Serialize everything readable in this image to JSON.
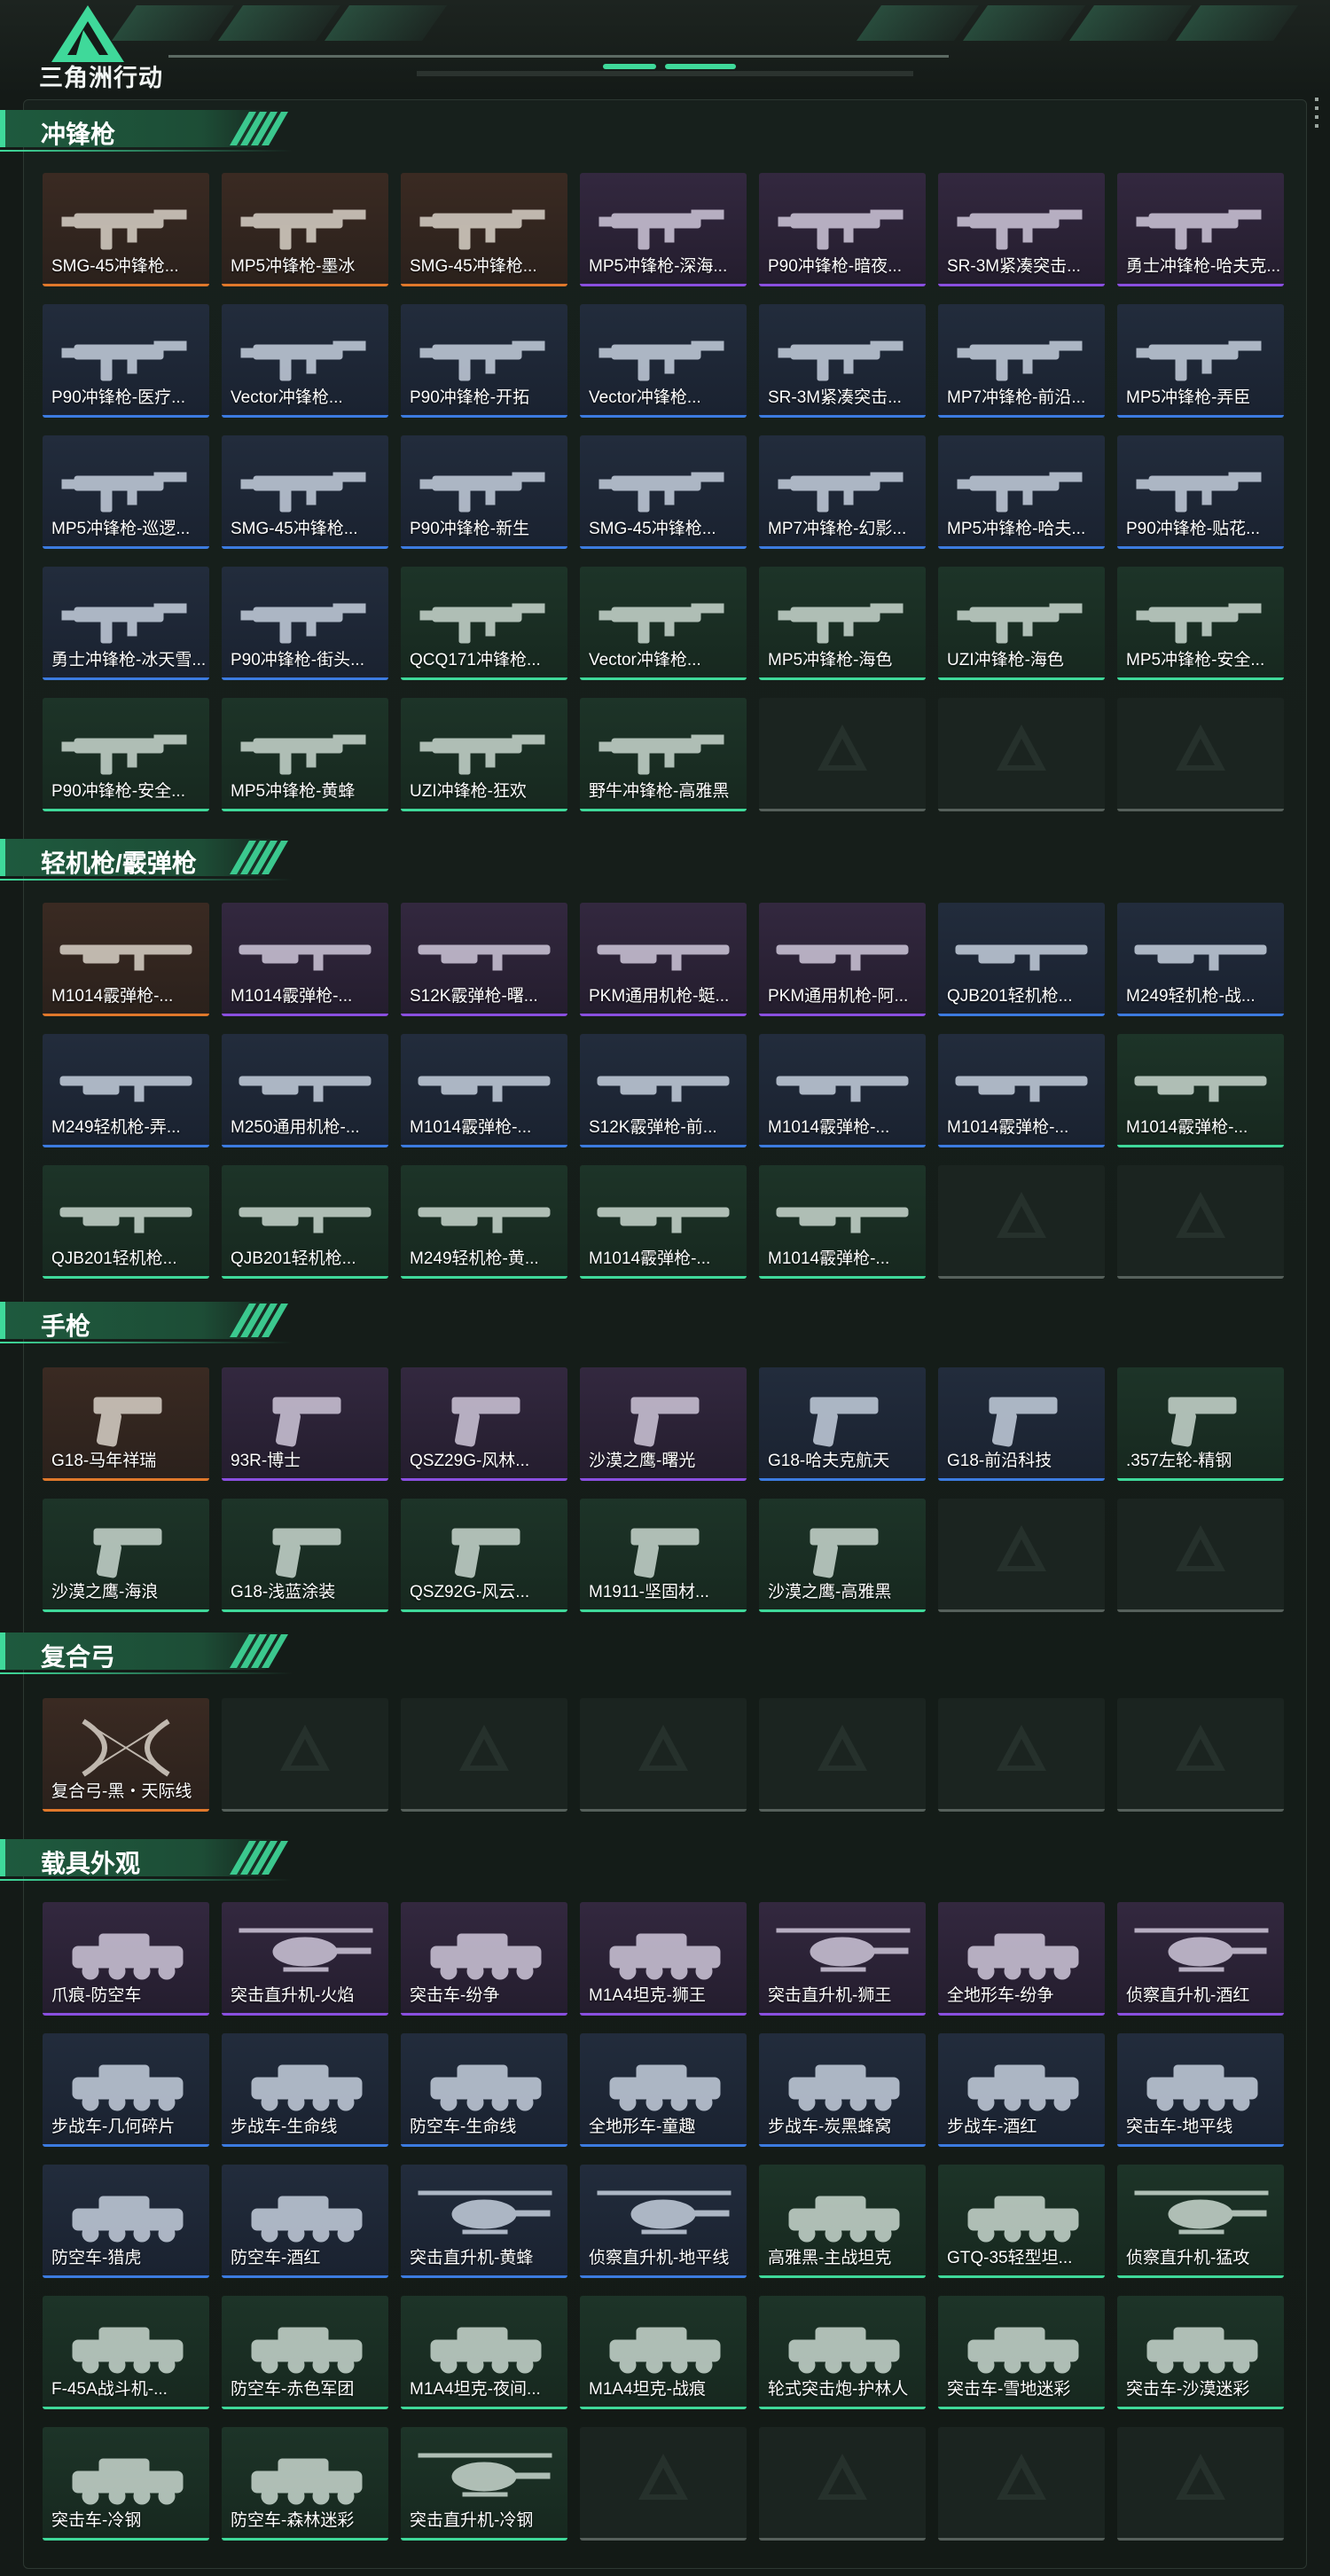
{
  "header": {
    "logo_text": "三角洲行动",
    "logo_icon": "delta-triangle-logo-icon",
    "accent_color": "#3fd99a"
  },
  "sections": [
    {
      "title": "冲锋枪",
      "cards": [
        {
          "label": "SMG-45冲锋枪...",
          "rarity": "orange"
        },
        {
          "label": "MP5冲锋枪-墨冰",
          "rarity": "orange"
        },
        {
          "label": "SMG-45冲锋枪...",
          "rarity": "orange"
        },
        {
          "label": "MP5冲锋枪-深海...",
          "rarity": "purple"
        },
        {
          "label": "P90冲锋枪-暗夜...",
          "rarity": "purple"
        },
        {
          "label": "SR-3M紧凑突击...",
          "rarity": "purple"
        },
        {
          "label": "勇士冲锋枪-哈夫克...",
          "rarity": "purple"
        },
        {
          "label": "P90冲锋枪-医疗...",
          "rarity": "blue"
        },
        {
          "label": "Vector冲锋枪...",
          "rarity": "blue"
        },
        {
          "label": "P90冲锋枪-开拓",
          "rarity": "blue"
        },
        {
          "label": "Vector冲锋枪...",
          "rarity": "blue"
        },
        {
          "label": "SR-3M紧凑突击...",
          "rarity": "blue"
        },
        {
          "label": "MP7冲锋枪-前沿...",
          "rarity": "blue"
        },
        {
          "label": "MP5冲锋枪-弄臣",
          "rarity": "blue"
        },
        {
          "label": "MP5冲锋枪-巡逻...",
          "rarity": "blue"
        },
        {
          "label": "SMG-45冲锋枪...",
          "rarity": "blue"
        },
        {
          "label": "P90冲锋枪-新生",
          "rarity": "blue"
        },
        {
          "label": "SMG-45冲锋枪...",
          "rarity": "blue"
        },
        {
          "label": "MP7冲锋枪-幻影...",
          "rarity": "blue"
        },
        {
          "label": "MP5冲锋枪-哈夫...",
          "rarity": "blue"
        },
        {
          "label": "P90冲锋枪-贴花...",
          "rarity": "blue"
        },
        {
          "label": "勇士冲锋枪-冰天雪...",
          "rarity": "blue"
        },
        {
          "label": "P90冲锋枪-街头...",
          "rarity": "blue"
        },
        {
          "label": "QCQ171冲锋枪...",
          "rarity": "green"
        },
        {
          "label": "Vector冲锋枪...",
          "rarity": "green"
        },
        {
          "label": "MP5冲锋枪-海色",
          "rarity": "green"
        },
        {
          "label": "UZI冲锋枪-海色",
          "rarity": "green"
        },
        {
          "label": "MP5冲锋枪-安全...",
          "rarity": "green"
        },
        {
          "label": "P90冲锋枪-安全...",
          "rarity": "green"
        },
        {
          "label": "MP5冲锋枪-黄蜂",
          "rarity": "green"
        },
        {
          "label": "UZI冲锋枪-狂欢",
          "rarity": "green"
        },
        {
          "label": "野牛冲锋枪-高雅黑",
          "rarity": "green"
        },
        {
          "label": "",
          "rarity": "empty"
        },
        {
          "label": "",
          "rarity": "empty"
        },
        {
          "label": "",
          "rarity": "empty"
        }
      ]
    },
    {
      "title": "轻机枪/霰弹枪",
      "cards": [
        {
          "label": "M1014霰弹枪-...",
          "rarity": "orange"
        },
        {
          "label": "M1014霰弹枪-...",
          "rarity": "purple"
        },
        {
          "label": "S12K霰弹枪-曙...",
          "rarity": "purple"
        },
        {
          "label": "PKM通用机枪-蜓...",
          "rarity": "purple"
        },
        {
          "label": "PKM通用机枪-阿...",
          "rarity": "purple"
        },
        {
          "label": "QJB201轻机枪...",
          "rarity": "blue"
        },
        {
          "label": "M249轻机枪-战...",
          "rarity": "blue"
        },
        {
          "label": "M249轻机枪-弄...",
          "rarity": "blue"
        },
        {
          "label": "M250通用机枪-...",
          "rarity": "blue"
        },
        {
          "label": "M1014霰弹枪-...",
          "rarity": "blue"
        },
        {
          "label": "S12K霰弹枪-前...",
          "rarity": "blue"
        },
        {
          "label": "M1014霰弹枪-...",
          "rarity": "blue"
        },
        {
          "label": "M1014霰弹枪-...",
          "rarity": "blue"
        },
        {
          "label": "M1014霰弹枪-...",
          "rarity": "green"
        },
        {
          "label": "QJB201轻机枪...",
          "rarity": "green"
        },
        {
          "label": "QJB201轻机枪...",
          "rarity": "green"
        },
        {
          "label": "M249轻机枪-黄...",
          "rarity": "green"
        },
        {
          "label": "M1014霰弹枪-...",
          "rarity": "green"
        },
        {
          "label": "M1014霰弹枪-...",
          "rarity": "green"
        },
        {
          "label": "",
          "rarity": "empty"
        },
        {
          "label": "",
          "rarity": "empty"
        }
      ]
    },
    {
      "title": "手枪",
      "cards": [
        {
          "label": "G18-马年祥瑞",
          "rarity": "orange"
        },
        {
          "label": "93R-博士",
          "rarity": "purple"
        },
        {
          "label": "QSZ29G-风林...",
          "rarity": "purple"
        },
        {
          "label": "沙漠之鹰-曙光",
          "rarity": "purple"
        },
        {
          "label": "G18-哈夫克航天",
          "rarity": "blue"
        },
        {
          "label": "G18-前沿科技",
          "rarity": "blue"
        },
        {
          "label": ".357左轮-精钢",
          "rarity": "green"
        },
        {
          "label": "沙漠之鹰-海浪",
          "rarity": "green"
        },
        {
          "label": "G18-浅蓝涂装",
          "rarity": "green"
        },
        {
          "label": "QSZ92G-风云...",
          "rarity": "green"
        },
        {
          "label": "M1911-坚固材...",
          "rarity": "green"
        },
        {
          "label": "沙漠之鹰-高雅黑",
          "rarity": "green"
        },
        {
          "label": "",
          "rarity": "empty"
        },
        {
          "label": "",
          "rarity": "empty"
        }
      ]
    },
    {
      "title": "复合弓",
      "cards": [
        {
          "label": "复合弓-黑・天际线",
          "rarity": "orange"
        },
        {
          "label": "",
          "rarity": "empty"
        },
        {
          "label": "",
          "rarity": "empty"
        },
        {
          "label": "",
          "rarity": "empty"
        },
        {
          "label": "",
          "rarity": "empty"
        },
        {
          "label": "",
          "rarity": "empty"
        },
        {
          "label": "",
          "rarity": "empty"
        }
      ]
    },
    {
      "title": "载具外观",
      "cards": [
        {
          "label": "爪痕-防空车",
          "rarity": "purple"
        },
        {
          "label": "突击直升机-火焰",
          "rarity": "purple"
        },
        {
          "label": "突击车-纷争",
          "rarity": "purple"
        },
        {
          "label": "M1A4坦克-狮王",
          "rarity": "purple"
        },
        {
          "label": "突击直升机-狮王",
          "rarity": "purple"
        },
        {
          "label": "全地形车-纷争",
          "rarity": "purple"
        },
        {
          "label": "侦察直升机-酒红",
          "rarity": "purple"
        },
        {
          "label": "步战车-几何碎片",
          "rarity": "blue"
        },
        {
          "label": "步战车-生命线",
          "rarity": "blue"
        },
        {
          "label": "防空车-生命线",
          "rarity": "blue"
        },
        {
          "label": "全地形车-童趣",
          "rarity": "blue"
        },
        {
          "label": "步战车-炭黑蜂窝",
          "rarity": "blue"
        },
        {
          "label": "步战车-酒红",
          "rarity": "blue"
        },
        {
          "label": "突击车-地平线",
          "rarity": "blue"
        },
        {
          "label": "防空车-猎虎",
          "rarity": "blue"
        },
        {
          "label": "防空车-酒红",
          "rarity": "blue"
        },
        {
          "label": "突击直升机-黄蜂",
          "rarity": "blue"
        },
        {
          "label": "侦察直升机-地平线",
          "rarity": "blue"
        },
        {
          "label": "高雅黑-主战坦克",
          "rarity": "green"
        },
        {
          "label": "GTQ-35轻型坦...",
          "rarity": "green"
        },
        {
          "label": "侦察直升机-猛攻",
          "rarity": "green"
        },
        {
          "label": "F-45A战斗机-...",
          "rarity": "green"
        },
        {
          "label": "防空车-赤色军团",
          "rarity": "green"
        },
        {
          "label": "M1A4坦克-夜间...",
          "rarity": "green"
        },
        {
          "label": "M1A4坦克-战痕",
          "rarity": "green"
        },
        {
          "label": "轮式突击炮-护林人",
          "rarity": "green"
        },
        {
          "label": "突击车-雪地迷彩",
          "rarity": "green"
        },
        {
          "label": "突击车-沙漠迷彩",
          "rarity": "green"
        },
        {
          "label": "突击车-冷钢",
          "rarity": "green"
        },
        {
          "label": "防空车-森林迷彩",
          "rarity": "green"
        },
        {
          "label": "突击直升机-冷钢",
          "rarity": "green"
        },
        {
          "label": "",
          "rarity": "empty"
        },
        {
          "label": "",
          "rarity": "empty"
        },
        {
          "label": "",
          "rarity": "empty"
        },
        {
          "label": "",
          "rarity": "empty"
        }
      ]
    }
  ],
  "colors": {
    "orange": "#e0782b",
    "purple": "#8a4fe0",
    "blue": "#3c7be0",
    "green": "#3fd99a",
    "empty": "#56605b"
  }
}
